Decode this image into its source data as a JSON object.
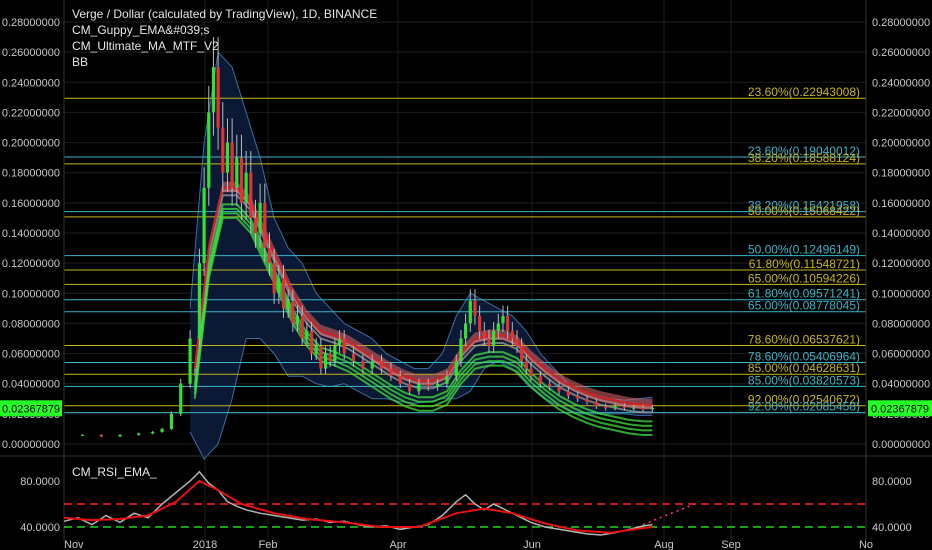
{
  "header": {
    "title": "Verge / Dollar (calculated by TradingView), 1D, BINANCE",
    "indicators": [
      "CM_Guppy_EMA&#039;s",
      "CM_Ultimate_MA_MTF_V2",
      "BB"
    ]
  },
  "colors": {
    "background": "#000000",
    "grid": "#1e1e1e",
    "fib_yellow": "#c8b41e",
    "fib_cyan": "#3cb4c8",
    "bb_fill": "#0c1c3a",
    "bb_line": "#3a6ea0",
    "price_tag": "#26ff26",
    "rsi_line": "#b4b4b4",
    "rsi_ema": "#e81010",
    "rsi_upper": "#ff2020",
    "rsi_lower": "#20d820",
    "projection": "#ff3c8c"
  },
  "price_axis": {
    "ticks": [
      "0.28000000",
      "0.26000000",
      "0.24000000",
      "0.22000000",
      "0.20000000",
      "0.18000000",
      "0.16000000",
      "0.14000000",
      "0.12000000",
      "0.10000000",
      "0.08000000",
      "0.06000000",
      "0.04000000",
      "0.02000000",
      "0.00000000"
    ],
    "last_price": "0.02367879"
  },
  "rsi": {
    "title": "CM_RSI_EMA_",
    "left_ticks": [
      "80.0000",
      "40.0000"
    ],
    "right_ticks": [
      "80.0000",
      "40.0000"
    ]
  },
  "time_axis": {
    "labels": [
      "Nov",
      "2018",
      "Feb",
      "Apr",
      "Jun",
      "Aug",
      "Sep",
      "No"
    ]
  },
  "chart_data": {
    "type": "line",
    "title": "Verge / Dollar (calculated by TradingView), 1D, BINANCE",
    "ylim": [
      -0.006,
      0.29
    ],
    "scale": "linear",
    "x_labels": [
      "Nov",
      "2018",
      "Feb",
      "Apr",
      "Jun",
      "Aug",
      "Sep",
      "No"
    ],
    "fib_levels": [
      {
        "label": "23.60%(0.22943008)",
        "value": 0.22943008,
        "color": "yellow"
      },
      {
        "label": "23.60%(0.19040012)",
        "value": 0.19040012,
        "color": "cyan"
      },
      {
        "label": "38.20%(0.18588124)",
        "value": 0.18588124,
        "color": "yellow"
      },
      {
        "label": "38.20%(0.15421958)",
        "value": 0.15421958,
        "color": "cyan"
      },
      {
        "label": "50.00%(0.15068422)",
        "value": 0.15068422,
        "color": "yellow"
      },
      {
        "label": "50.00%(0.12496149)",
        "value": 0.12496149,
        "color": "cyan"
      },
      {
        "label": "61.80%(0.11548721)",
        "value": 0.11548721,
        "color": "yellow"
      },
      {
        "label": "65.00%(0.10594226)",
        "value": 0.10594226,
        "color": "yellow"
      },
      {
        "label": "61.80%(0.09571241)",
        "value": 0.09571241,
        "color": "cyan"
      },
      {
        "label": "65.00%(0.08778045)",
        "value": 0.08778045,
        "color": "cyan"
      },
      {
        "label": "78.60%(0.06537621)",
        "value": 0.06537621,
        "color": "yellow"
      },
      {
        "label": "78.60%(0.05406964)",
        "value": 0.05406964,
        "color": "cyan"
      },
      {
        "label": "85.00%(0.04628631)",
        "value": 0.04628631,
        "color": "yellow"
      },
      {
        "label": "85.00%(0.03820573)",
        "value": 0.03820573,
        "color": "cyan"
      },
      {
        "label": "92.00%(0.02540672)",
        "value": 0.02540672,
        "color": "yellow"
      },
      {
        "label": "92.00%(0.02085458)",
        "value": 0.02085458,
        "color": "cyan"
      }
    ],
    "price_series": [
      [
        0,
        0.006
      ],
      [
        4,
        0.006
      ],
      [
        8,
        0.005
      ],
      [
        12,
        0.006
      ],
      [
        16,
        0.007
      ],
      [
        19,
        0.008
      ],
      [
        21,
        0.01
      ],
      [
        23,
        0.02
      ],
      [
        25,
        0.04
      ],
      [
        27,
        0.07
      ],
      [
        29,
        0.12
      ],
      [
        30,
        0.17
      ],
      [
        31,
        0.22
      ],
      [
        32,
        0.25
      ],
      [
        33,
        0.21
      ],
      [
        34,
        0.18
      ],
      [
        35,
        0.2
      ],
      [
        36,
        0.17
      ],
      [
        37,
        0.19
      ],
      [
        38,
        0.16
      ],
      [
        39,
        0.18
      ],
      [
        40,
        0.15
      ],
      [
        41,
        0.14
      ],
      [
        42,
        0.16
      ],
      [
        43,
        0.13
      ],
      [
        44,
        0.12
      ],
      [
        45,
        0.1
      ],
      [
        46,
        0.11
      ],
      [
        47,
        0.09
      ],
      [
        48,
        0.095
      ],
      [
        49,
        0.08
      ],
      [
        50,
        0.085
      ],
      [
        51,
        0.07
      ],
      [
        52,
        0.075
      ],
      [
        53,
        0.06
      ],
      [
        54,
        0.065
      ],
      [
        55,
        0.05
      ],
      [
        56,
        0.06
      ],
      [
        57,
        0.055
      ],
      [
        58,
        0.065
      ],
      [
        59,
        0.07
      ],
      [
        60,
        0.06
      ],
      [
        62,
        0.055
      ],
      [
        64,
        0.05
      ],
      [
        66,
        0.055
      ],
      [
        68,
        0.05
      ],
      [
        70,
        0.045
      ],
      [
        72,
        0.04
      ],
      [
        74,
        0.035
      ],
      [
        76,
        0.04
      ],
      [
        78,
        0.038
      ],
      [
        80,
        0.04
      ],
      [
        82,
        0.045
      ],
      [
        84,
        0.055
      ],
      [
        85,
        0.07
      ],
      [
        86,
        0.08
      ],
      [
        87,
        0.095
      ],
      [
        88,
        0.085
      ],
      [
        89,
        0.075
      ],
      [
        90,
        0.07
      ],
      [
        91,
        0.065
      ],
      [
        92,
        0.075
      ],
      [
        93,
        0.08
      ],
      [
        94,
        0.085
      ],
      [
        95,
        0.075
      ],
      [
        96,
        0.07
      ],
      [
        97,
        0.065
      ],
      [
        98,
        0.055
      ],
      [
        99,
        0.05
      ],
      [
        100,
        0.045
      ],
      [
        102,
        0.04
      ],
      [
        104,
        0.038
      ],
      [
        106,
        0.035
      ],
      [
        108,
        0.032
      ],
      [
        110,
        0.03
      ],
      [
        112,
        0.028
      ],
      [
        114,
        0.025
      ],
      [
        116,
        0.024
      ],
      [
        118,
        0.025
      ],
      [
        120,
        0.024
      ],
      [
        122,
        0.024
      ],
      [
        124,
        0.023
      ],
      [
        126,
        0.024
      ]
    ],
    "bb_upper": [
      [
        27,
        0.09
      ],
      [
        30,
        0.2
      ],
      [
        33,
        0.26
      ],
      [
        36,
        0.25
      ],
      [
        39,
        0.22
      ],
      [
        42,
        0.19
      ],
      [
        45,
        0.15
      ],
      [
        48,
        0.13
      ],
      [
        51,
        0.12
      ],
      [
        54,
        0.1
      ],
      [
        57,
        0.09
      ],
      [
        60,
        0.08
      ],
      [
        63,
        0.075
      ],
      [
        66,
        0.07
      ],
      [
        69,
        0.06
      ],
      [
        72,
        0.055
      ],
      [
        75,
        0.05
      ],
      [
        78,
        0.05
      ],
      [
        81,
        0.06
      ],
      [
        84,
        0.085
      ],
      [
        87,
        0.1
      ],
      [
        90,
        0.095
      ],
      [
        93,
        0.09
      ],
      [
        96,
        0.085
      ],
      [
        99,
        0.075
      ],
      [
        102,
        0.06
      ],
      [
        105,
        0.05
      ],
      [
        108,
        0.04
      ],
      [
        111,
        0.035
      ],
      [
        114,
        0.032
      ],
      [
        117,
        0.03
      ],
      [
        120,
        0.029
      ],
      [
        123,
        0.03
      ],
      [
        126,
        0.031
      ]
    ],
    "bb_lower": [
      [
        27,
        0.008
      ],
      [
        30,
        -0.01
      ],
      [
        33,
        0.0
      ],
      [
        36,
        0.03
      ],
      [
        39,
        0.07
      ],
      [
        42,
        0.07
      ],
      [
        45,
        0.06
      ],
      [
        48,
        0.045
      ],
      [
        51,
        0.045
      ],
      [
        54,
        0.04
      ],
      [
        57,
        0.038
      ],
      [
        60,
        0.04
      ],
      [
        63,
        0.035
      ],
      [
        66,
        0.03
      ],
      [
        69,
        0.03
      ],
      [
        72,
        0.028
      ],
      [
        75,
        0.027
      ],
      [
        78,
        0.028
      ],
      [
        81,
        0.03
      ],
      [
        84,
        0.03
      ],
      [
        87,
        0.035
      ],
      [
        90,
        0.05
      ],
      [
        93,
        0.055
      ],
      [
        96,
        0.05
      ],
      [
        99,
        0.04
      ],
      [
        102,
        0.032
      ],
      [
        105,
        0.027
      ],
      [
        108,
        0.022
      ],
      [
        111,
        0.02
      ],
      [
        114,
        0.02
      ],
      [
        117,
        0.02
      ],
      [
        120,
        0.02
      ],
      [
        123,
        0.019
      ],
      [
        126,
        0.019
      ]
    ],
    "ma_red": [
      [
        28,
        0.05
      ],
      [
        31,
        0.13
      ],
      [
        34,
        0.17
      ],
      [
        37,
        0.17
      ],
      [
        40,
        0.16
      ],
      [
        43,
        0.14
      ],
      [
        46,
        0.12
      ],
      [
        49,
        0.1
      ],
      [
        52,
        0.085
      ],
      [
        55,
        0.075
      ],
      [
        58,
        0.072
      ],
      [
        61,
        0.068
      ],
      [
        64,
        0.062
      ],
      [
        67,
        0.056
      ],
      [
        70,
        0.05
      ],
      [
        73,
        0.045
      ],
      [
        76,
        0.042
      ],
      [
        79,
        0.042
      ],
      [
        82,
        0.046
      ],
      [
        85,
        0.06
      ],
      [
        88,
        0.07
      ],
      [
        91,
        0.072
      ],
      [
        94,
        0.072
      ],
      [
        97,
        0.068
      ],
      [
        100,
        0.058
      ],
      [
        103,
        0.05
      ],
      [
        106,
        0.043
      ],
      [
        109,
        0.038
      ],
      [
        112,
        0.034
      ],
      [
        115,
        0.031
      ],
      [
        118,
        0.029
      ],
      [
        121,
        0.027
      ],
      [
        124,
        0.026
      ],
      [
        126,
        0.026
      ]
    ],
    "rsi_series": [
      [
        0,
        45
      ],
      [
        3,
        48
      ],
      [
        6,
        42
      ],
      [
        9,
        50
      ],
      [
        12,
        44
      ],
      [
        15,
        52
      ],
      [
        18,
        48
      ],
      [
        21,
        60
      ],
      [
        24,
        70
      ],
      [
        27,
        80
      ],
      [
        29,
        88
      ],
      [
        31,
        78
      ],
      [
        33,
        72
      ],
      [
        35,
        62
      ],
      [
        37,
        58
      ],
      [
        39,
        55
      ],
      [
        42,
        52
      ],
      [
        45,
        50
      ],
      [
        48,
        48
      ],
      [
        51,
        46
      ],
      [
        54,
        47
      ],
      [
        57,
        44
      ],
      [
        60,
        45
      ],
      [
        63,
        42
      ],
      [
        66,
        40
      ],
      [
        69,
        41
      ],
      [
        72,
        38
      ],
      [
        75,
        40
      ],
      [
        78,
        42
      ],
      [
        81,
        50
      ],
      [
        84,
        62
      ],
      [
        86,
        68
      ],
      [
        88,
        60
      ],
      [
        90,
        55
      ],
      [
        92,
        60
      ],
      [
        94,
        56
      ],
      [
        96,
        52
      ],
      [
        98,
        48
      ],
      [
        100,
        44
      ],
      [
        103,
        40
      ],
      [
        106,
        38
      ],
      [
        109,
        36
      ],
      [
        112,
        34
      ],
      [
        115,
        33
      ],
      [
        118,
        35
      ],
      [
        121,
        38
      ],
      [
        124,
        41
      ],
      [
        126,
        42
      ]
    ],
    "rsi_ema": [
      [
        0,
        48
      ],
      [
        6,
        46
      ],
      [
        12,
        47
      ],
      [
        18,
        50
      ],
      [
        24,
        62
      ],
      [
        29,
        80
      ],
      [
        33,
        72
      ],
      [
        38,
        60
      ],
      [
        45,
        52
      ],
      [
        52,
        47
      ],
      [
        60,
        44
      ],
      [
        68,
        40
      ],
      [
        76,
        40
      ],
      [
        84,
        52
      ],
      [
        90,
        56
      ],
      [
        96,
        52
      ],
      [
        103,
        43
      ],
      [
        110,
        37
      ],
      [
        117,
        35
      ],
      [
        124,
        39
      ],
      [
        126,
        40
      ]
    ],
    "rsi_projection": [
      [
        124,
        42
      ],
      [
        135,
        60
      ]
    ],
    "rsi_levels": {
      "upper": 60,
      "lower": 40
    }
  }
}
